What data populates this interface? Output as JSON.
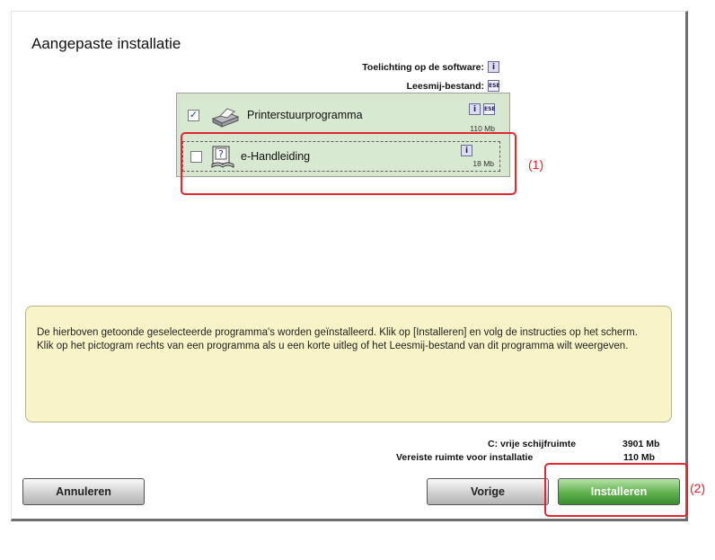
{
  "dialog": {
    "title": "Aangepaste installatie",
    "software_info_label": "Toelichting op de software:",
    "readme_label": "Leesmij-bestand:",
    "info_icon_glyph": "i",
    "readme_icon_glyph": "ESE"
  },
  "components": [
    {
      "label": "Printerstuurprogramma",
      "checked": true,
      "size": "110 Mb",
      "icon": "printer-icon"
    },
    {
      "label": "e-Handleiding",
      "checked": false,
      "size": "18 Mb",
      "icon": "manual-book-icon"
    }
  ],
  "check_glyph": "✓",
  "callouts": {
    "one": "(1)",
    "two": "(2)"
  },
  "note": "De hierboven getoonde geselecteerde programma's worden geïnstalleerd. Klik op [Installeren] en volg de instructies op het scherm. Klik op het pictogram rechts van een programma als u een korte uitleg of het Leesmij-bestand van dit programma wilt weergeven.",
  "disk": {
    "free_label": "C: vrije schijfruimte",
    "free_value": "3901 Mb",
    "required_label": "Vereiste ruimte voor installatie",
    "required_value": "110 Mb"
  },
  "buttons": {
    "cancel": "Annuleren",
    "back": "Vorige",
    "install": "Installeren"
  },
  "colors": {
    "highlight_red": "#e0282d",
    "install_green": "#4fa33f",
    "note_bg": "#f9f4c8",
    "list_bg": "#d7e6cf"
  }
}
